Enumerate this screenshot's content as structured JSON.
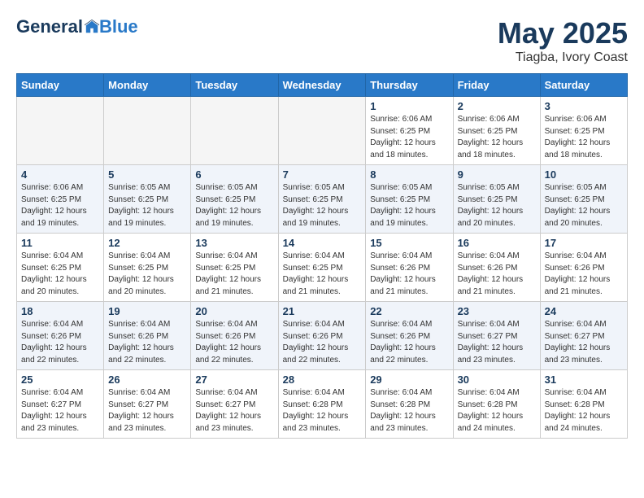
{
  "header": {
    "logo_general": "General",
    "logo_blue": "Blue",
    "month_year": "May 2025",
    "location": "Tiagba, Ivory Coast"
  },
  "days_of_week": [
    "Sunday",
    "Monday",
    "Tuesday",
    "Wednesday",
    "Thursday",
    "Friday",
    "Saturday"
  ],
  "weeks": [
    [
      {
        "num": "",
        "info": ""
      },
      {
        "num": "",
        "info": ""
      },
      {
        "num": "",
        "info": ""
      },
      {
        "num": "",
        "info": ""
      },
      {
        "num": "1",
        "info": "Sunrise: 6:06 AM\nSunset: 6:25 PM\nDaylight: 12 hours\nand 18 minutes."
      },
      {
        "num": "2",
        "info": "Sunrise: 6:06 AM\nSunset: 6:25 PM\nDaylight: 12 hours\nand 18 minutes."
      },
      {
        "num": "3",
        "info": "Sunrise: 6:06 AM\nSunset: 6:25 PM\nDaylight: 12 hours\nand 18 minutes."
      }
    ],
    [
      {
        "num": "4",
        "info": "Sunrise: 6:06 AM\nSunset: 6:25 PM\nDaylight: 12 hours\nand 19 minutes."
      },
      {
        "num": "5",
        "info": "Sunrise: 6:05 AM\nSunset: 6:25 PM\nDaylight: 12 hours\nand 19 minutes."
      },
      {
        "num": "6",
        "info": "Sunrise: 6:05 AM\nSunset: 6:25 PM\nDaylight: 12 hours\nand 19 minutes."
      },
      {
        "num": "7",
        "info": "Sunrise: 6:05 AM\nSunset: 6:25 PM\nDaylight: 12 hours\nand 19 minutes."
      },
      {
        "num": "8",
        "info": "Sunrise: 6:05 AM\nSunset: 6:25 PM\nDaylight: 12 hours\nand 19 minutes."
      },
      {
        "num": "9",
        "info": "Sunrise: 6:05 AM\nSunset: 6:25 PM\nDaylight: 12 hours\nand 20 minutes."
      },
      {
        "num": "10",
        "info": "Sunrise: 6:05 AM\nSunset: 6:25 PM\nDaylight: 12 hours\nand 20 minutes."
      }
    ],
    [
      {
        "num": "11",
        "info": "Sunrise: 6:04 AM\nSunset: 6:25 PM\nDaylight: 12 hours\nand 20 minutes."
      },
      {
        "num": "12",
        "info": "Sunrise: 6:04 AM\nSunset: 6:25 PM\nDaylight: 12 hours\nand 20 minutes."
      },
      {
        "num": "13",
        "info": "Sunrise: 6:04 AM\nSunset: 6:25 PM\nDaylight: 12 hours\nand 21 minutes."
      },
      {
        "num": "14",
        "info": "Sunrise: 6:04 AM\nSunset: 6:25 PM\nDaylight: 12 hours\nand 21 minutes."
      },
      {
        "num": "15",
        "info": "Sunrise: 6:04 AM\nSunset: 6:26 PM\nDaylight: 12 hours\nand 21 minutes."
      },
      {
        "num": "16",
        "info": "Sunrise: 6:04 AM\nSunset: 6:26 PM\nDaylight: 12 hours\nand 21 minutes."
      },
      {
        "num": "17",
        "info": "Sunrise: 6:04 AM\nSunset: 6:26 PM\nDaylight: 12 hours\nand 21 minutes."
      }
    ],
    [
      {
        "num": "18",
        "info": "Sunrise: 6:04 AM\nSunset: 6:26 PM\nDaylight: 12 hours\nand 22 minutes."
      },
      {
        "num": "19",
        "info": "Sunrise: 6:04 AM\nSunset: 6:26 PM\nDaylight: 12 hours\nand 22 minutes."
      },
      {
        "num": "20",
        "info": "Sunrise: 6:04 AM\nSunset: 6:26 PM\nDaylight: 12 hours\nand 22 minutes."
      },
      {
        "num": "21",
        "info": "Sunrise: 6:04 AM\nSunset: 6:26 PM\nDaylight: 12 hours\nand 22 minutes."
      },
      {
        "num": "22",
        "info": "Sunrise: 6:04 AM\nSunset: 6:26 PM\nDaylight: 12 hours\nand 22 minutes."
      },
      {
        "num": "23",
        "info": "Sunrise: 6:04 AM\nSunset: 6:27 PM\nDaylight: 12 hours\nand 23 minutes."
      },
      {
        "num": "24",
        "info": "Sunrise: 6:04 AM\nSunset: 6:27 PM\nDaylight: 12 hours\nand 23 minutes."
      }
    ],
    [
      {
        "num": "25",
        "info": "Sunrise: 6:04 AM\nSunset: 6:27 PM\nDaylight: 12 hours\nand 23 minutes."
      },
      {
        "num": "26",
        "info": "Sunrise: 6:04 AM\nSunset: 6:27 PM\nDaylight: 12 hours\nand 23 minutes."
      },
      {
        "num": "27",
        "info": "Sunrise: 6:04 AM\nSunset: 6:27 PM\nDaylight: 12 hours\nand 23 minutes."
      },
      {
        "num": "28",
        "info": "Sunrise: 6:04 AM\nSunset: 6:28 PM\nDaylight: 12 hours\nand 23 minutes."
      },
      {
        "num": "29",
        "info": "Sunrise: 6:04 AM\nSunset: 6:28 PM\nDaylight: 12 hours\nand 23 minutes."
      },
      {
        "num": "30",
        "info": "Sunrise: 6:04 AM\nSunset: 6:28 PM\nDaylight: 12 hours\nand 24 minutes."
      },
      {
        "num": "31",
        "info": "Sunrise: 6:04 AM\nSunset: 6:28 PM\nDaylight: 12 hours\nand 24 minutes."
      }
    ]
  ]
}
